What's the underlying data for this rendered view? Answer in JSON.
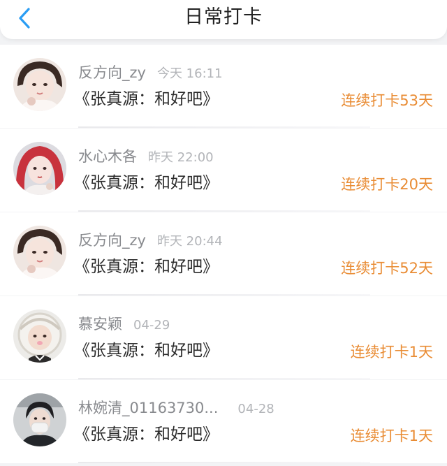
{
  "header": {
    "title": "日常打卡",
    "back_icon": "chevron-left-icon",
    "accent": "#2a9df4"
  },
  "colors": {
    "streak": "#e98c34",
    "username": "#888a8e",
    "time": "#b2b4b8"
  },
  "items": [
    {
      "username": "反方向_zy",
      "time": "今天 16:11",
      "book": "《张真源：和好吧》",
      "streak": "连续打卡53天",
      "avatar": "user-avatar-1"
    },
    {
      "username": "水心木各",
      "time": "昨天 22:00",
      "book": "《张真源：和好吧》",
      "streak": "连续打卡20天",
      "avatar": "user-avatar-2"
    },
    {
      "username": "反方向_zy",
      "time": "昨天 20:44",
      "book": "《张真源：和好吧》",
      "streak": "连续打卡52天",
      "avatar": "user-avatar-1"
    },
    {
      "username": "慕安颖",
      "time": "04-29",
      "book": "《张真源：和好吧》",
      "streak": "连续打卡1天",
      "avatar": "user-avatar-3"
    },
    {
      "username": "林婉清_01163730...",
      "time": "04-28",
      "book": "《张真源：和好吧》",
      "streak": "连续打卡1天",
      "avatar": "user-avatar-4"
    }
  ]
}
